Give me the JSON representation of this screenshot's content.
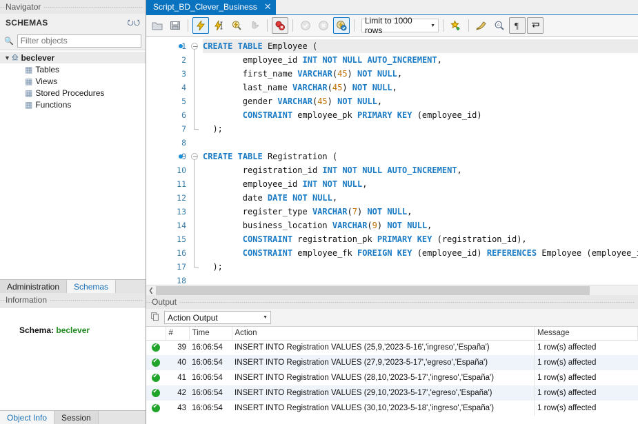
{
  "sidebar": {
    "navigator_caption": "Navigator",
    "schemas_header": "SCHEMAS",
    "refresh_icon": "refresh-icon",
    "search_icon": "search-icon",
    "filter_placeholder": "Filter objects",
    "filter_value": "",
    "tree": {
      "root": "beclever",
      "children": [
        "Tables",
        "Views",
        "Stored Procedures",
        "Functions"
      ]
    },
    "tabs": [
      {
        "label": "Administration",
        "active": false
      },
      {
        "label": "Schemas",
        "active": true
      }
    ],
    "information_caption": "Information",
    "info": {
      "schema_label": "Schema:",
      "schema_value": "beclever"
    },
    "bottom_tabs": [
      {
        "label": "Object Info",
        "active": true
      },
      {
        "label": "Session",
        "active": false
      }
    ]
  },
  "editor_tab": {
    "title": "Script_BD_Clever_Business",
    "close_icon": "close-icon"
  },
  "toolbar": {
    "buttons": [
      {
        "name": "open-script-icon",
        "glyph": "folder"
      },
      {
        "name": "save-script-icon",
        "glyph": "floppy"
      },
      {
        "name": "execute-statement-icon",
        "glyph": "bolt",
        "state": "selected"
      },
      {
        "name": "execute-current-statement-icon",
        "glyph": "bolt-cursor"
      },
      {
        "name": "explain-statement-icon",
        "glyph": "bolt-magnifier"
      },
      {
        "name": "stop-execution-icon",
        "glyph": "hand",
        "state": "disabled"
      },
      {
        "name": "toggle-stop-on-error-icon",
        "glyph": "stop-error"
      },
      {
        "name": "commit-icon",
        "glyph": "check",
        "state": "disabled"
      },
      {
        "name": "rollback-icon",
        "glyph": "cross",
        "state": "disabled"
      },
      {
        "name": "toggle-autocommit-icon",
        "glyph": "autocommit",
        "state": "selected"
      }
    ],
    "limit_label": "Limit to 1000 rows",
    "limit_arrow": "chevron-down-icon",
    "right_buttons": [
      {
        "name": "save-snippet-icon",
        "glyph": "star-plus"
      },
      {
        "name": "beautify-query-icon",
        "glyph": "brush"
      },
      {
        "name": "find-icon",
        "glyph": "magnifier-a"
      },
      {
        "name": "toggle-invisible-chars-icon",
        "glyph": "pilcrow"
      },
      {
        "name": "toggle-wrapping-icon",
        "glyph": "wrap-arrow"
      }
    ]
  },
  "code_lines": [
    {
      "n": 1,
      "bp": true,
      "fold": "start",
      "html": "<span class='kw'>CREATE</span> <span class='kw'>TABLE</span> Employee (",
      "highlight": true
    },
    {
      "n": 2,
      "bp": false,
      "fold": "mid",
      "html": "        employee_id <span class='typ'>INT</span> <span class='kw'>NOT</span> <span class='kw'>NULL</span> <span class='kw'>AUTO_INCREMENT</span>,"
    },
    {
      "n": 3,
      "bp": false,
      "fold": "mid",
      "html": "        first_name <span class='typ'>VARCHAR</span>(<span class='num'>45</span>) <span class='kw'>NOT</span> <span class='kw'>NULL</span>,"
    },
    {
      "n": 4,
      "bp": false,
      "fold": "mid",
      "html": "        last_name <span class='typ'>VARCHAR</span>(<span class='num'>45</span>) <span class='kw'>NOT</span> <span class='kw'>NULL</span>,"
    },
    {
      "n": 5,
      "bp": false,
      "fold": "mid",
      "html": "        gender <span class='typ'>VARCHAR</span>(<span class='num'>45</span>) <span class='kw'>NOT</span> <span class='kw'>NULL</span>,"
    },
    {
      "n": 6,
      "bp": false,
      "fold": "mid",
      "html": "        <span class='kw'>CONSTRAINT</span> employee_pk <span class='kw'>PRIMARY</span> <span class='kw'>KEY</span> (employee_id)"
    },
    {
      "n": 7,
      "bp": false,
      "fold": "end",
      "html": "  );"
    },
    {
      "n": 8,
      "bp": false,
      "fold": "none",
      "html": ""
    },
    {
      "n": 9,
      "bp": true,
      "fold": "start",
      "html": "<span class='kw'>CREATE</span> <span class='kw'>TABLE</span> Registration ("
    },
    {
      "n": 10,
      "bp": false,
      "fold": "mid",
      "html": "        registration_id <span class='typ'>INT</span> <span class='kw'>NOT</span> <span class='kw'>NULL</span> <span class='kw'>AUTO_INCREMENT</span>,"
    },
    {
      "n": 11,
      "bp": false,
      "fold": "mid",
      "html": "        employee_id <span class='typ'>INT</span> <span class='kw'>NOT</span> <span class='kw'>NULL</span>,"
    },
    {
      "n": 12,
      "bp": false,
      "fold": "mid",
      "html": "        date <span class='typ'>DATE</span> <span class='kw'>NOT</span> <span class='kw'>NULL</span>,"
    },
    {
      "n": 13,
      "bp": false,
      "fold": "mid",
      "html": "        register_type <span class='typ'>VARCHAR</span>(<span class='num'>7</span>) <span class='kw'>NOT</span> <span class='kw'>NULL</span>,"
    },
    {
      "n": 14,
      "bp": false,
      "fold": "mid",
      "html": "        business_location <span class='typ'>VARCHAR</span>(<span class='num'>9</span>) <span class='kw'>NOT</span> <span class='kw'>NULL</span>,"
    },
    {
      "n": 15,
      "bp": false,
      "fold": "mid",
      "html": "        <span class='kw'>CONSTRAINT</span> registration_pk <span class='kw'>PRIMARY</span> <span class='kw'>KEY</span> (registration_id),"
    },
    {
      "n": 16,
      "bp": false,
      "fold": "mid",
      "html": "        <span class='kw'>CONSTRAINT</span> employee_fk <span class='kw'>FOREIGN</span> <span class='kw'>KEY</span> (employee_id) <span class='kw'>REFERENCES</span> Employee (employee_id)"
    },
    {
      "n": 17,
      "bp": false,
      "fold": "end",
      "html": "  );"
    },
    {
      "n": 18,
      "bp": false,
      "fold": "none",
      "html": ""
    }
  ],
  "output": {
    "caption": "Output",
    "copy_icon": "copy-icon",
    "select_value": "Action Output",
    "select_arrow": "chevron-down-icon",
    "columns": [
      "",
      "#",
      "Time",
      "Action",
      "Message"
    ],
    "rows": [
      {
        "status": "success-icon",
        "num": "39",
        "time": "16:06:54",
        "action": "INSERT INTO Registration VALUES (25,9,'2023-5-16','ingreso','España')",
        "message": "1 row(s) affected"
      },
      {
        "status": "success-icon",
        "num": "40",
        "time": "16:06:54",
        "action": "INSERT INTO Registration VALUES (27,9,'2023-5-17','egreso','España')",
        "message": "1 row(s) affected"
      },
      {
        "status": "success-icon",
        "num": "41",
        "time": "16:06:54",
        "action": "INSERT INTO Registration VALUES (28,10,'2023-5-17','ingreso','España')",
        "message": "1 row(s) affected"
      },
      {
        "status": "success-icon",
        "num": "42",
        "time": "16:06:54",
        "action": "INSERT INTO Registration VALUES (29,10,'2023-5-17','egreso','España')",
        "message": "1 row(s) affected"
      },
      {
        "status": "success-icon",
        "num": "43",
        "time": "16:06:54",
        "action": "INSERT INTO Registration VALUES (30,10,'2023-5-18','ingreso','España')",
        "message": "1 row(s) affected"
      }
    ]
  },
  "colors": {
    "accent_blue": "#0a73c0",
    "keyword_blue": "#1b7bc4",
    "number_orange": "#c07000",
    "schema_green": "#1f8a1f",
    "success_green": "#20a52a"
  }
}
